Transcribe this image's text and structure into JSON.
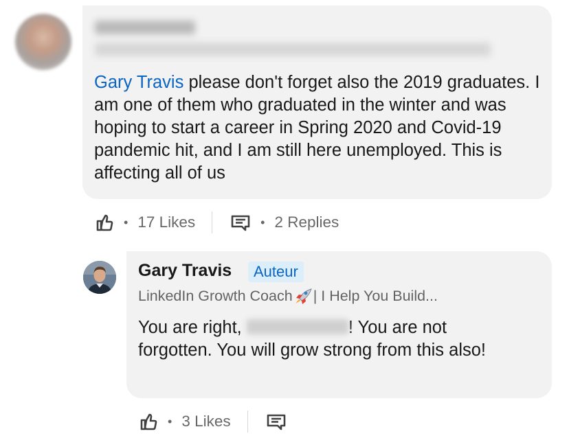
{
  "comment": {
    "author_name": "",
    "author_headline": "",
    "mention": "Gary Travis",
    "text": " please don't forget also the 2019 graduates. I am one of them who graduated in the winter and was hoping to start a career in Spring 2020 and Covid-19 pandemic hit, and I am still here unemployed. This is affecting all of us",
    "likes_label": "17 Likes",
    "replies_label": "2 Replies",
    "separator": "•"
  },
  "reply": {
    "author_name": "Gary Travis",
    "author_badge": "Auteur",
    "headline_before": "LinkedIn Growth Coach",
    "headline_after": "| I Help You Build...",
    "text_before": "You are right, ",
    "text_after": "! You are not forgotten. You will grow strong from this also!",
    "likes_label": "3 Likes",
    "separator": "•"
  },
  "icons": {
    "like": "like-thumb-icon",
    "reply": "reply-bubble-icon",
    "rocket": "rocket-emoji-icon"
  },
  "colors": {
    "mention": "#0a66c2",
    "bubble": "#f2f2f2",
    "badge_bg": "#dbeefa"
  }
}
